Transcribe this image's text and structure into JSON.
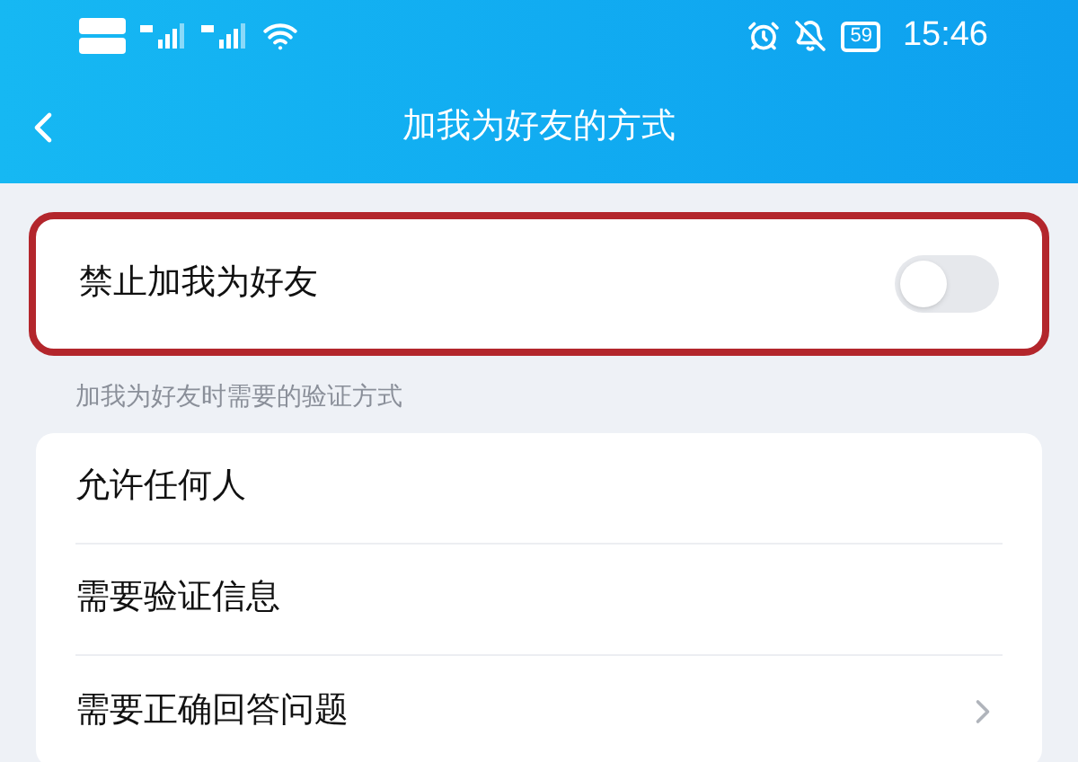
{
  "status_bar": {
    "battery": "59",
    "time": "15:46"
  },
  "header": {
    "title": "加我为好友的方式"
  },
  "block_toggle": {
    "label": "禁止加我为好友",
    "on": false,
    "highlighted": true
  },
  "section_label": "加我为好友时需要的验证方式",
  "options": [
    {
      "label": "允许任何人",
      "kind": "plain"
    },
    {
      "label": "需要验证信息",
      "kind": "plain"
    },
    {
      "label": "需要正确回答问题",
      "kind": "arrow"
    }
  ]
}
